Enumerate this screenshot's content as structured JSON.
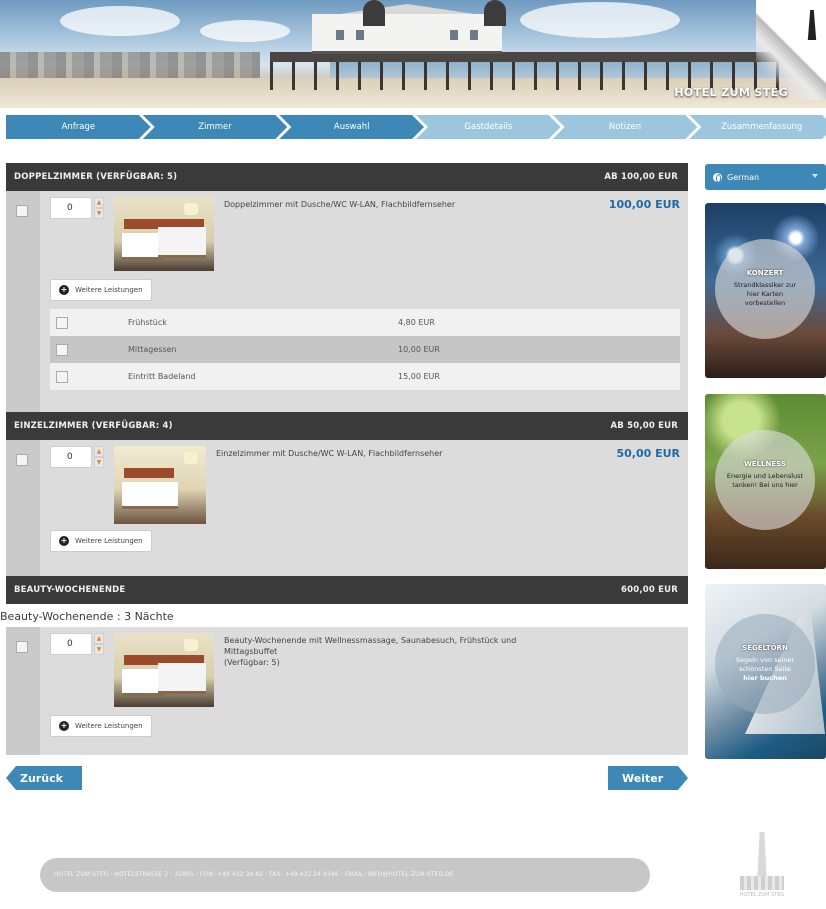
{
  "header": {
    "hotel_name": "HOTEL ZUM STEG"
  },
  "steps": [
    {
      "label": "Anfrage",
      "done": true
    },
    {
      "label": "Zimmer",
      "done": true
    },
    {
      "label": "Auswahl",
      "done": true
    },
    {
      "label": "Gastdetails",
      "done": false
    },
    {
      "label": "Notizen",
      "done": false
    },
    {
      "label": "Zusammenfassung",
      "done": false
    }
  ],
  "categories": {
    "doppel": {
      "title": "DOPPELZIMMER (VERFÜGBAR: 5)",
      "from_price": "AB 100,00 EUR",
      "qty": "0",
      "description": "Doppelzimmer mit Dusche/WC W-LAN, Flachbildfernseher",
      "price": "100,00 EUR",
      "extras_label": "Weitere Leistungen",
      "services": [
        {
          "name": "Frühstück",
          "price": "4,80 EUR"
        },
        {
          "name": "Mittagessen",
          "price": "10,00 EUR"
        },
        {
          "name": "Eintritt Badeland",
          "price": "15,00 EUR"
        }
      ]
    },
    "einzel": {
      "title": "EINZELZIMMER (VERFÜGBAR: 4)",
      "from_price": "AB 50,00 EUR",
      "qty": "0",
      "description": "Einzelzimmer mit Dusche/WC W-LAN, Flachbildfernseher",
      "price": "50,00 EUR",
      "extras_label": "Weitere Leistungen"
    },
    "beauty": {
      "title": "BEAUTY-WOCHENENDE",
      "from_price": "600,00 EUR",
      "package_title": "Beauty-Wochenende : 3 Nächte",
      "qty": "0",
      "description_line1": "Beauty-Wochenende mit Wellnessmassage, Saunabesuch, Frühstück und",
      "description_line2": "Mittagsbuffet",
      "description_line3": "(Verfügbar: 5)",
      "extras_label": "Weitere Leistungen"
    }
  },
  "nav": {
    "back": "Zurück",
    "next": "Weiter"
  },
  "sidebar": {
    "language": "German",
    "promos": [
      {
        "title": "KONZERT",
        "line1": "Strandklassiker zur",
        "line2": "hier Karten",
        "line3": "vorbestellen"
      },
      {
        "title": "WELLNESS",
        "line1": "Energie und Lebenslust",
        "line2": "tanken! Bei uns hier"
      },
      {
        "title": "SEGELTÖRN",
        "line1": "Segeln von seiner",
        "line2": "schönsten Seite",
        "line3": "hier buchen"
      }
    ]
  },
  "footer": {
    "text": "HOTEL ZUM STEG · HOTELSTRASSE 2 · 32805 · FON: +49 432 34 82 · FAX: +49 432 24 8346 · EMAIL: INFO@HOTEL-ZUM-STEG.DE",
    "logo_text": "HOTEL ZUM STEG"
  }
}
